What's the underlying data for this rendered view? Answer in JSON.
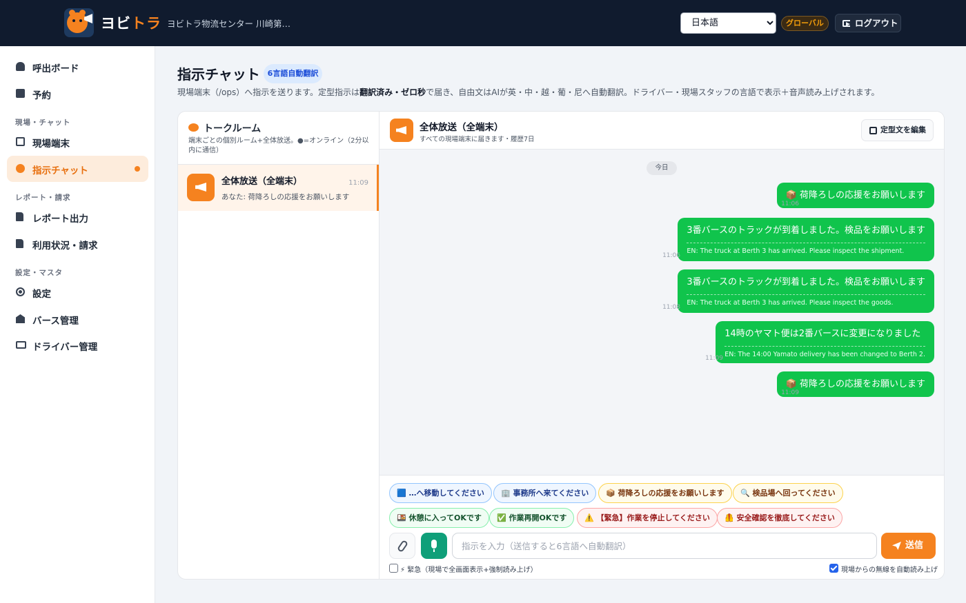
{
  "header": {
    "brand_part1": "ヨビ",
    "brand_part2": "トラ",
    "center_name": "ヨビトラ物流センター 川崎第…",
    "language": "日本語",
    "global_badge": "グローバル",
    "logout_label": "ログアウト"
  },
  "sidebar": {
    "items": [
      {
        "label": "呼出ボード",
        "icon": "bell-icon"
      },
      {
        "label": "予約",
        "icon": "calendar-icon"
      },
      {
        "label": "現場端末",
        "icon": "tablet-icon"
      },
      {
        "label": "指示チャット",
        "icon": "chat-icon",
        "active": true
      },
      {
        "label": "レポート出力",
        "icon": "file-export-icon"
      },
      {
        "label": "利用状況・請求",
        "icon": "invoice-icon"
      },
      {
        "label": "設定",
        "icon": "gear-icon"
      },
      {
        "label": "バース管理",
        "icon": "warehouse-icon"
      },
      {
        "label": "ドライバー管理",
        "icon": "id-card-icon"
      }
    ],
    "sections": [
      "現場・チャット",
      "レポート・請求",
      "設定・マスタ"
    ]
  },
  "page": {
    "title": "指示チャット",
    "badge": "6言語自動翻訳",
    "desc_1": "現場端末（/ops）へ指示を送ります。定型指示は",
    "desc_bold": "翻訳済み・ゼロ秒",
    "desc_2": "で届き、自由文はAIが英・中・越・葡・尼へ自動翻訳。ドライバー・現場スタッフの言語で表示＋音声読み上げされます。"
  },
  "rooms": {
    "title": "トークルーム",
    "subtitle": "端末ごとの個別ルーム+全体放送。●=オンライン（2分以内に通信）",
    "list": [
      {
        "name": "全体放送（全端末）",
        "time": "11:09",
        "last": "あなた: 荷降ろしの応援をお願いします"
      }
    ]
  },
  "chat": {
    "title": "全体放送（全端末）",
    "subtitle": "すべての現場端末に届きます・履歴7日",
    "edit_label": "定型文を編集",
    "day_label": "今日",
    "messages": [
      {
        "text": "📦 荷降ろしの応援をお願いします",
        "time": "11:06"
      },
      {
        "text": "3番バースのトラックが到着しました。検品をお願いします",
        "translation": "EN: The truck at Berth 3 has arrived. Please inspect the shipment.",
        "time": "11:06"
      },
      {
        "text": "3番バースのトラックが到着しました。検品をお願いします",
        "translation": "EN: The truck at Berth 3 has arrived. Please inspect the goods.",
        "time": "11:08"
      },
      {
        "text": "14時のヤマト便は2番バースに変更になりました",
        "translation": "EN: The 14:00 Yamato delivery has been changed to Berth 2.",
        "time": "11:09"
      },
      {
        "text": "📦 荷降ろしの応援をお願いします",
        "time": "11:09"
      }
    ]
  },
  "quick_phrases": [
    {
      "label": "🟦 …へ移動してください",
      "style": "blue"
    },
    {
      "label": "🏢 事務所へ来てください",
      "style": "blue"
    },
    {
      "label": "📦 荷降ろしの応援をお願いします",
      "style": "amber"
    },
    {
      "label": "🔍 検品場へ回ってください",
      "style": "amber"
    },
    {
      "label": "🍱 休憩に入ってOKです",
      "style": "green"
    },
    {
      "label": "✅ 作業再開OKです",
      "style": "green"
    },
    {
      "label": "⚠️ 【緊急】作業を停止してください",
      "style": "red"
    },
    {
      "label": "🦺 安全確認を徹底してください",
      "style": "red"
    }
  ],
  "composer": {
    "placeholder": "指示を入力（送信すると6言語へ自動翻訳）",
    "send_label": "送信",
    "urgent_label": "⚡ 緊急（現場で全画面表示+強制読み上げ）",
    "autoread_label": "現場からの無線を自動読み上げ"
  },
  "colors": {
    "accent": "#f5821f",
    "bubble": "#10c44c",
    "header_bg": "#101b2e"
  }
}
